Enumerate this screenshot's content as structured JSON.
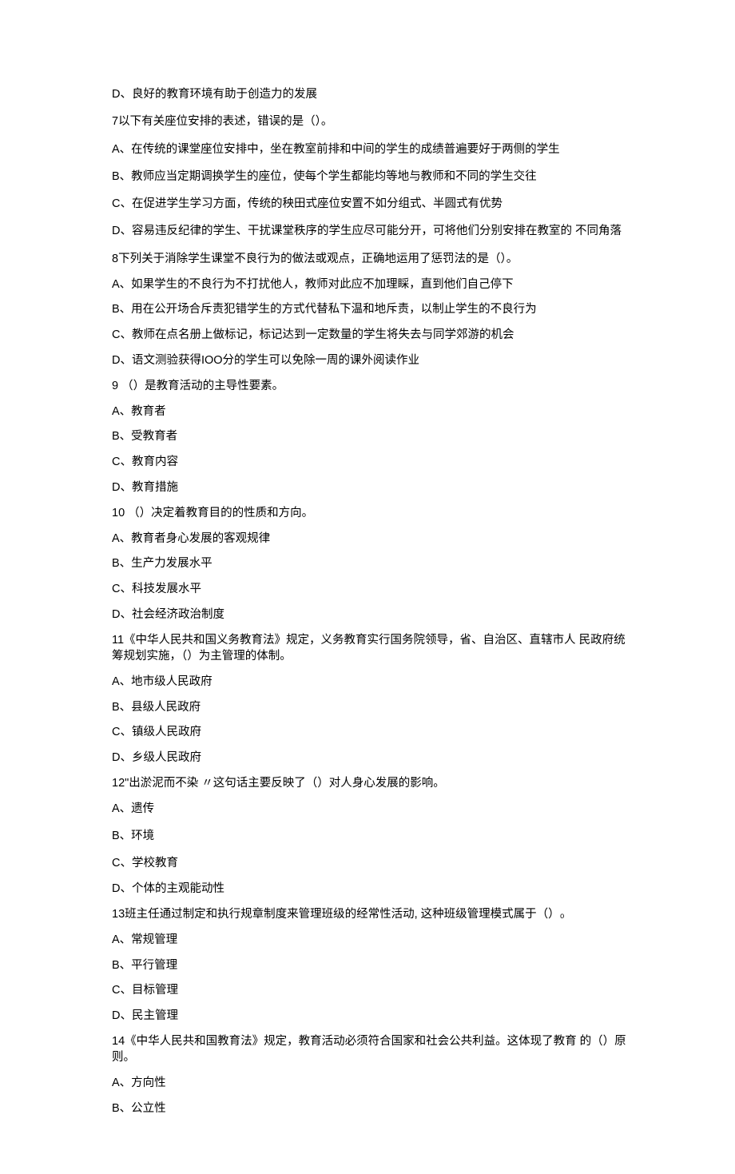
{
  "lines": [
    {
      "id": "q6-d",
      "text": "D、良好的教育环境有助于创造力的发展",
      "cls": "spaced"
    },
    {
      "id": "q7",
      "text": "7以下有关座位安排的表述，错误的是（）。",
      "cls": "spaced"
    },
    {
      "id": "q7-a",
      "text": "A、在传统的课堂座位安排中，坐在教室前排和中间的学生的成绩普遍要好于两侧的学生",
      "cls": "spaced"
    },
    {
      "id": "q7-b",
      "text": "B、教师应当定期调换学生的座位，使每个学生都能均等地与教师和不同的学生交往",
      "cls": "spaced"
    },
    {
      "id": "q7-c",
      "text": "C、在促进学生学习方面，传统的秧田式座位安置不如分组式、半圆式有优势",
      "cls": "spaced"
    },
    {
      "id": "q7-d",
      "text": "D、容易违反纪律的学生、干扰课堂秩序的学生应尽可能分开，可将他们分别安排在教室的 不同角落",
      "cls": "spaced"
    },
    {
      "id": "q8",
      "text": "8下列关于消除学生课堂不良行为的做法或观点，正确地运用了惩罚法的是（）。",
      "cls": ""
    },
    {
      "id": "q8-a",
      "text": "A、如果学生的不良行为不打扰他人，教师对此应不加理睬，直到他们自己停下",
      "cls": ""
    },
    {
      "id": "q8-b",
      "text": "B、用在公开场合斥责犯错学生的方式代替私下温和地斥责，以制止学生的不良行为",
      "cls": ""
    },
    {
      "id": "q8-c",
      "text": "C、教师在点名册上做标记，标记达到一定数量的学生将失去与同学郊游的机会",
      "cls": ""
    },
    {
      "id": "q8-d",
      "text": "D、语文测验获得IOO分的学生可以免除一周的课外阅读作业",
      "cls": ""
    },
    {
      "id": "q9",
      "text": "9 （）是教育活动的主导性要素。",
      "cls": ""
    },
    {
      "id": "q9-a",
      "text": "A、教育者",
      "cls": ""
    },
    {
      "id": "q9-b",
      "text": "B、受教育者",
      "cls": ""
    },
    {
      "id": "q9-c",
      "text": "C、教育内容",
      "cls": ""
    },
    {
      "id": "q9-d",
      "text": "D、教育措施",
      "cls": ""
    },
    {
      "id": "q10",
      "text": "10 （）决定着教育目的的性质和方向。",
      "cls": ""
    },
    {
      "id": "q10-a",
      "text": "A、教育者身心发展的客观规律",
      "cls": ""
    },
    {
      "id": "q10-b",
      "text": "B、生产力发展水平",
      "cls": ""
    },
    {
      "id": "q10-c",
      "text": "C、科技发展水平",
      "cls": ""
    },
    {
      "id": "q10-d",
      "text": "D、社会经济政治制度",
      "cls": ""
    },
    {
      "id": "q11",
      "text": "11《中华人民共和国义务教育法》规定，义务教育实行国务院领导，省、自治区、直辖市人 民政府统筹规划实施，（）为主管理的体制。",
      "cls": ""
    },
    {
      "id": "q11-a",
      "text": "A、地市级人民政府",
      "cls": ""
    },
    {
      "id": "q11-b",
      "text": "B、县级人民政府",
      "cls": ""
    },
    {
      "id": "q11-c",
      "text": "C、镇级人民政府",
      "cls": ""
    },
    {
      "id": "q11-d",
      "text": "D、乡级人民政府",
      "cls": ""
    },
    {
      "id": "q12",
      "text": "12\"出淤泥而不染 〃这句话主要反映了（）对人身心发展的影响。",
      "cls": ""
    },
    {
      "id": "q12-a",
      "text": "A、遗传",
      "cls": "spaced"
    },
    {
      "id": "q12-b",
      "text": "B、环境",
      "cls": "spaced"
    },
    {
      "id": "q12-c",
      "text": "C、学校教育",
      "cls": ""
    },
    {
      "id": "q12-d",
      "text": "D、个体的主观能动性",
      "cls": ""
    },
    {
      "id": "q13",
      "text": "13班主任通过制定和执行规章制度来管理班级的经常性活动, 这种班级管理模式属于（）₀",
      "cls": ""
    },
    {
      "id": "q13-a",
      "text": "A、常规管理",
      "cls": ""
    },
    {
      "id": "q13-b",
      "text": "B、平行管理",
      "cls": ""
    },
    {
      "id": "q13-c",
      "text": "C、目标管理",
      "cls": ""
    },
    {
      "id": "q13-d",
      "text": "D、民主管理",
      "cls": ""
    },
    {
      "id": "q14",
      "text": "14《中华人民共和国教育法》规定，教育活动必须符合国家和社会公共利益。这体现了教育 的（）原则。",
      "cls": ""
    },
    {
      "id": "q14-a",
      "text": "A、方向性",
      "cls": ""
    },
    {
      "id": "q14-b",
      "text": "B、公立性",
      "cls": ""
    }
  ]
}
